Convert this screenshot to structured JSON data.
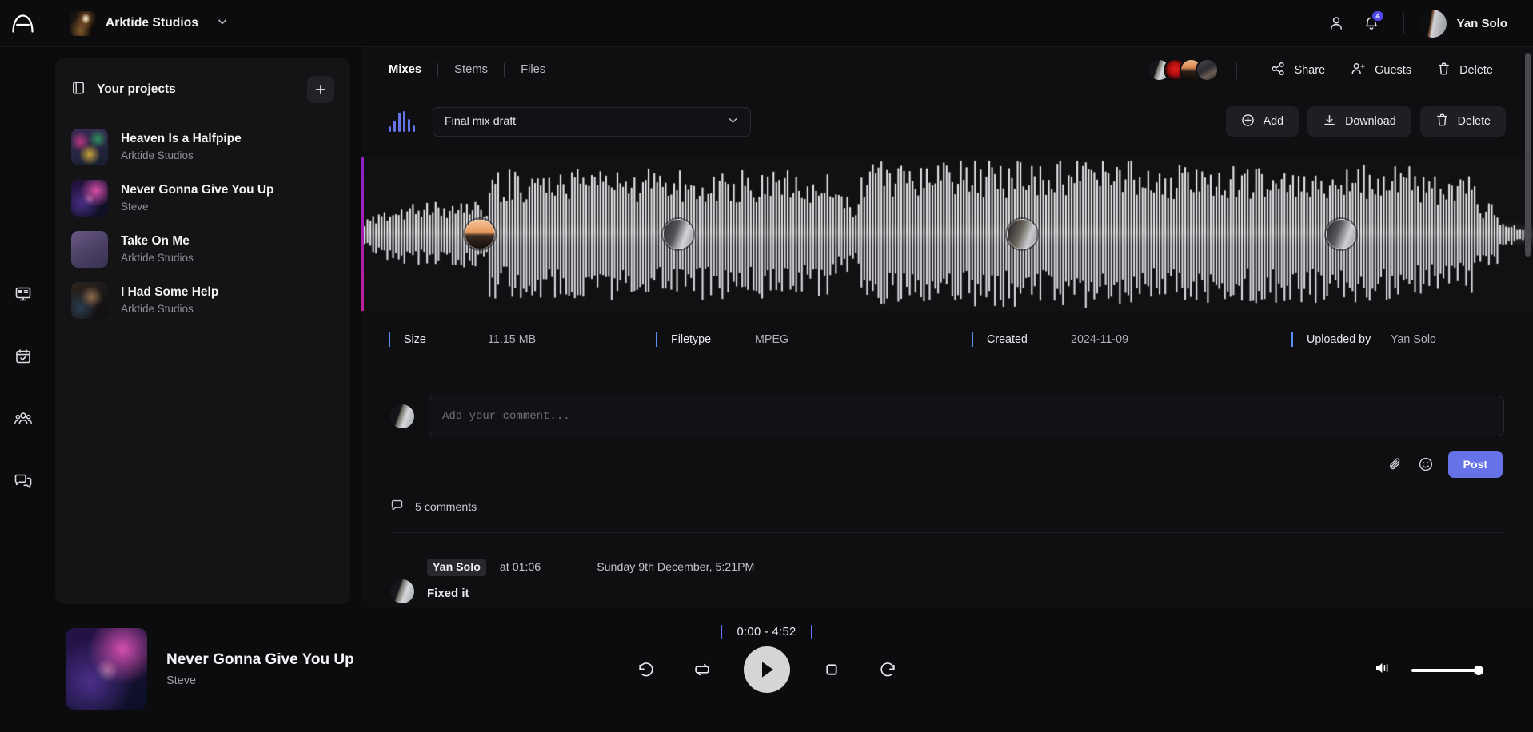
{
  "topbar": {
    "logo_icon": "arktide-logo-icon",
    "workspace": "Arktide Studios",
    "workspace_chevron_icon": "chevron-down-icon",
    "profile_icon": "user-icon",
    "notifications_icon": "bell-icon",
    "notification_count": "4",
    "user_name": "Yan Solo"
  },
  "rail": {
    "items": [
      {
        "icon": "dashboard-monitor-icon",
        "name": "dashboard"
      },
      {
        "icon": "calendar-check-icon",
        "name": "calendar"
      },
      {
        "icon": "people-group-icon",
        "name": "people"
      },
      {
        "icon": "chat-bubbles-icon",
        "name": "messages"
      }
    ]
  },
  "projects": {
    "header_icon": "book-icon",
    "title": "Your projects",
    "add_icon": "plus-icon",
    "items": [
      {
        "name": "Heaven Is a Halfpipe",
        "owner": "Arktide Studios"
      },
      {
        "name": "Never Gonna Give You Up",
        "owner": "Steve"
      },
      {
        "name": "Take On Me",
        "owner": "Arktide Studios"
      },
      {
        "name": "I Had Some Help",
        "owner": "Arktide Studios"
      }
    ]
  },
  "main": {
    "tabs": [
      {
        "label": "Mixes",
        "active": true
      },
      {
        "label": "Stems",
        "active": false
      },
      {
        "label": "Files",
        "active": false
      }
    ],
    "collaborators_count": 4,
    "share_label": "Share",
    "share_icon": "share-icon",
    "guests_label": "Guests",
    "guests_icon": "user-plus-icon",
    "delete_label": "Delete",
    "delete_icon": "trash-icon",
    "mix_icon": "waveform-icon",
    "mix_selected": "Final mix draft",
    "mix_chevron_icon": "chevron-down-icon",
    "add_label": "Add",
    "add_icon": "plus-circle-icon",
    "download_label": "Download",
    "download_icon": "download-icon",
    "delete_mix_label": "Delete",
    "delete_mix_icon": "trash-icon"
  },
  "meta": [
    {
      "label": "Size",
      "value": "11.15 MB"
    },
    {
      "label": "Filetype",
      "value": "MPEG"
    },
    {
      "label": "Created",
      "value": "2024-11-09"
    },
    {
      "label": "Uploaded by",
      "value": "Yan Solo"
    }
  ],
  "composer": {
    "placeholder": "Add your comment...",
    "value": "",
    "attach_icon": "paperclip-icon",
    "emoji_icon": "smiley-icon",
    "post_label": "Post"
  },
  "comments": {
    "count_icon": "comment-icon",
    "count_label": "5 comments",
    "items": [
      {
        "author": "Yan Solo",
        "timestamp_label": "at 01:06",
        "date": "Sunday 9th December, 5:21PM",
        "text": "Fixed it"
      }
    ]
  },
  "player": {
    "title": "Never Gonna Give You Up",
    "artist": "Steve",
    "time_range": "0:00 - 4:52",
    "controls": [
      {
        "icon": "rewind-icon",
        "name": "rewind-button"
      },
      {
        "icon": "loop-icon",
        "name": "loop-button"
      },
      {
        "icon": "play-icon",
        "name": "play-button"
      },
      {
        "icon": "stop-icon",
        "name": "stop-button"
      },
      {
        "icon": "forward-icon",
        "name": "forward-button"
      }
    ],
    "volume_icon": "volume-icon",
    "volume_percent": 93
  },
  "waveform": {
    "playhead_position_percent": 0,
    "markers_percent": [
      8.8,
      25.7,
      55.1,
      82.3
    ]
  },
  "colors": {
    "accent_blue": "#6572e8",
    "meta_bar": "#5b8ff5",
    "playhead": "#b522b5",
    "badge": "#4f46e5"
  }
}
